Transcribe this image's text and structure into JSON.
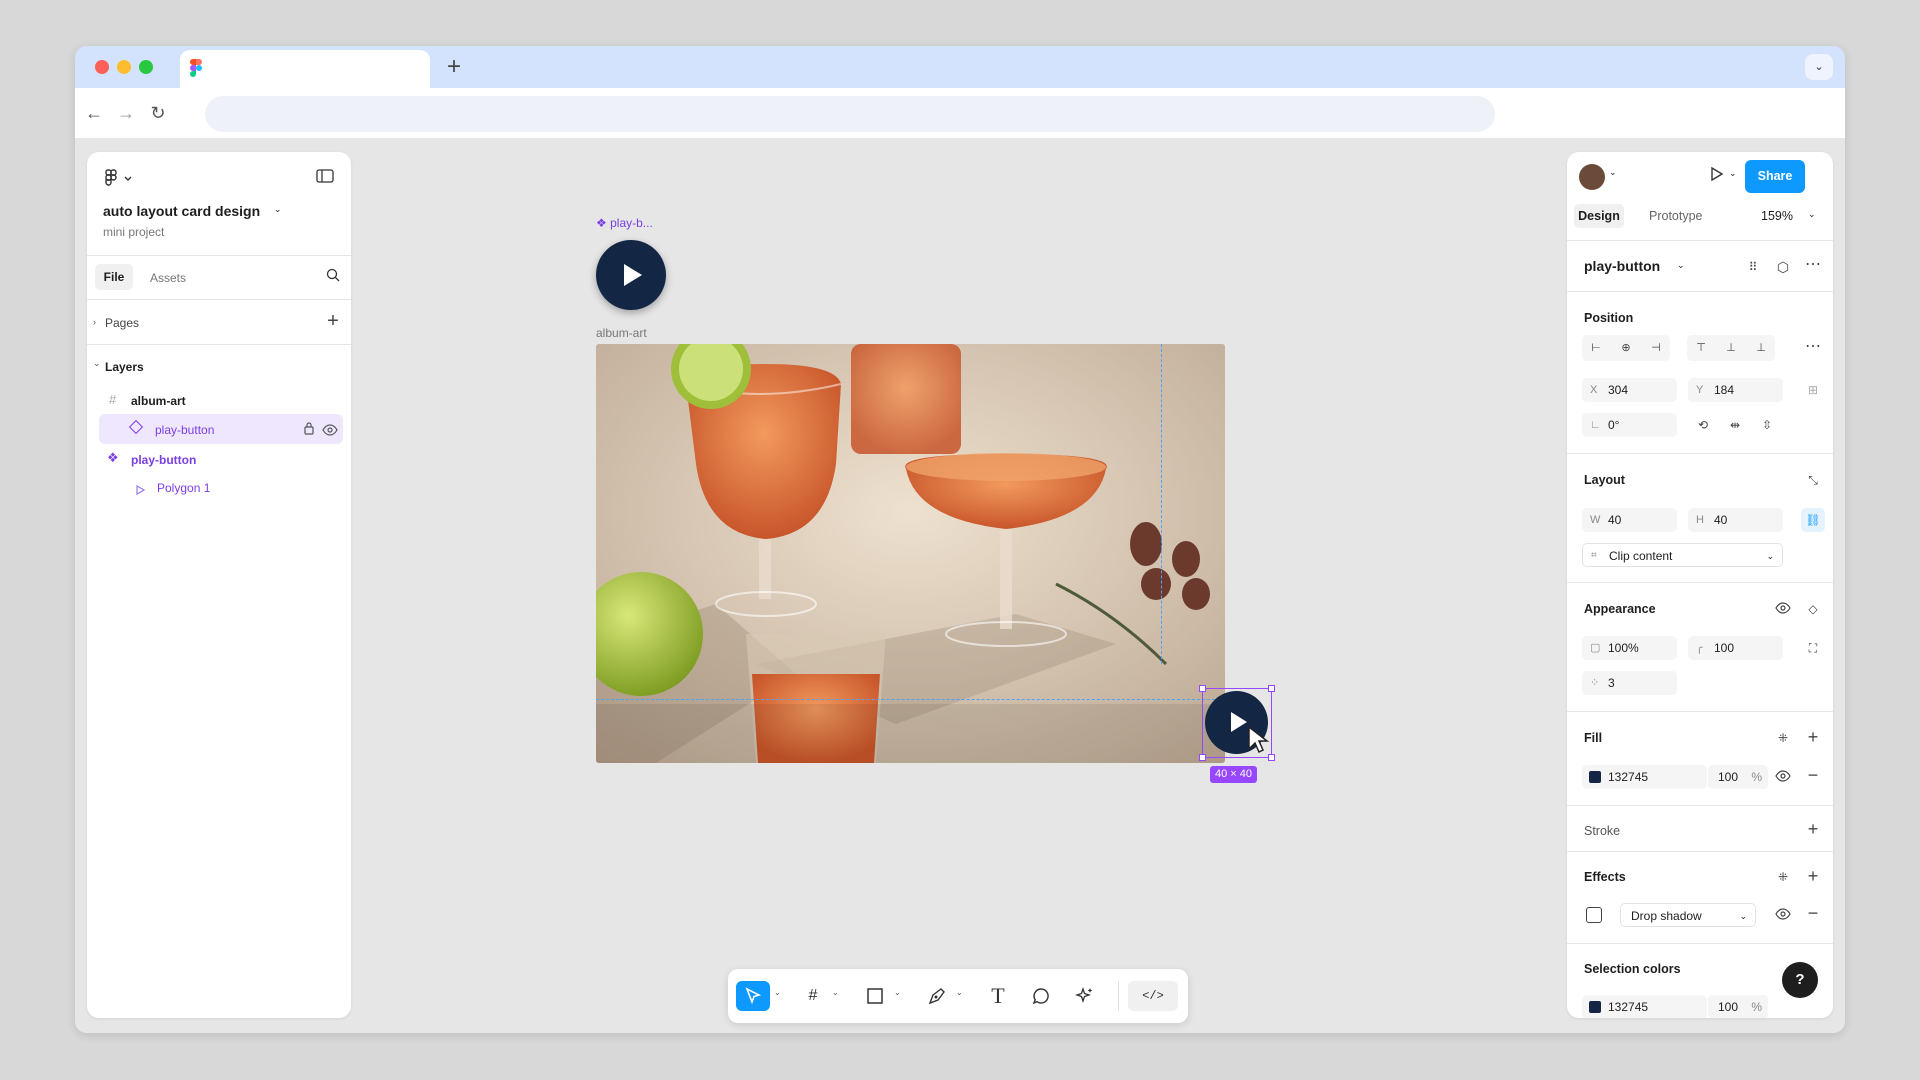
{
  "browser": {
    "new_tab_symbol": "+",
    "tab_menu_symbol": "⌄"
  },
  "file": {
    "title": "auto layout card design",
    "project": "mini project"
  },
  "left_panel": {
    "tabs": [
      "File",
      "Assets"
    ],
    "pages_label": "Pages",
    "layers_label": "Layers",
    "layers": [
      {
        "name": "album-art"
      },
      {
        "name": "play-button"
      },
      {
        "name": "play-button"
      },
      {
        "name": "Polygon 1"
      }
    ]
  },
  "canvas": {
    "component_label": "play-b...",
    "frame_label": "album-art",
    "selection_size": "40 × 40"
  },
  "right_panel": {
    "share": "Share",
    "tabs": [
      "Design",
      "Prototype"
    ],
    "zoom": "159%",
    "selection_name": "play-button",
    "position": {
      "title": "Position",
      "x_label": "X",
      "x": "304",
      "y_label": "Y",
      "y": "184",
      "rotation": "0°"
    },
    "layout": {
      "title": "Layout",
      "w_label": "W",
      "w": "40",
      "h_label": "H",
      "h": "40",
      "clip": "Clip content"
    },
    "appearance": {
      "title": "Appearance",
      "opacity": "100%",
      "radius": "100",
      "count": "3"
    },
    "fill": {
      "title": "Fill",
      "hex": "132745",
      "opacity": "100",
      "unit": "%"
    },
    "stroke": {
      "title": "Stroke"
    },
    "effects": {
      "title": "Effects",
      "effect": "Drop shadow"
    },
    "selection_colors": {
      "title": "Selection colors",
      "hex": "132745",
      "opacity": "100",
      "unit": "%"
    },
    "help": "?"
  },
  "colors": {
    "accent": "#0d99ff",
    "component": "#7b3fe4",
    "fill": "#132745",
    "selection": "#9747ff"
  }
}
